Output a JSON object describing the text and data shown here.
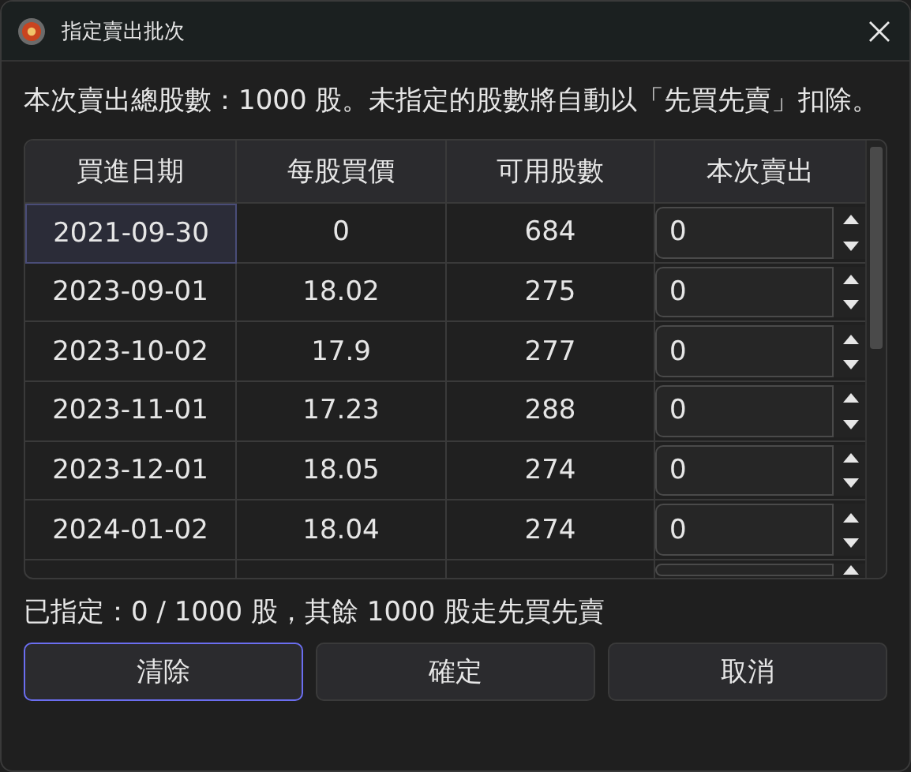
{
  "window": {
    "title": "指定賣出批次"
  },
  "message": "本次賣出總股數：1000 股。未指定的股數將自動以「先買先賣」扣除。",
  "table": {
    "columns": [
      "買進日期",
      "每股買價",
      "可用股數",
      "本次賣出"
    ],
    "rows": [
      {
        "date": "2021-09-30",
        "price": "0",
        "available": "684",
        "sell": "0",
        "selected": true
      },
      {
        "date": "2023-09-01",
        "price": "18.02",
        "available": "275",
        "sell": "0",
        "selected": false
      },
      {
        "date": "2023-10-02",
        "price": "17.9",
        "available": "277",
        "sell": "0",
        "selected": false
      },
      {
        "date": "2023-11-01",
        "price": "17.23",
        "available": "288",
        "sell": "0",
        "selected": false
      },
      {
        "date": "2023-12-01",
        "price": "18.05",
        "available": "274",
        "sell": "0",
        "selected": false
      },
      {
        "date": "2024-01-02",
        "price": "18.04",
        "available": "274",
        "sell": "0",
        "selected": false
      }
    ]
  },
  "status": "已指定：0 / 1000 股，其餘 1000 股走先買先賣",
  "buttons": [
    {
      "label": "清除",
      "focused": true
    },
    {
      "label": "確定",
      "focused": false
    },
    {
      "label": "取消",
      "focused": false
    }
  ]
}
